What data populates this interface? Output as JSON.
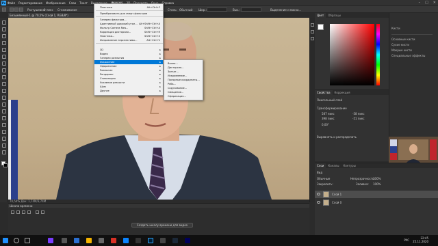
{
  "app": {
    "logo_text": "Ps",
    "menus": [
      "Файл",
      "Редактирование",
      "Изображение",
      "Слои",
      "Текст",
      "Выделение",
      "Фильтр",
      "3D",
      "Просмотр",
      "Окно",
      "Справка"
    ],
    "active_menu_index": 6
  },
  "options": {
    "feather_label": "Растушевка:",
    "feather_value": "0 пикс",
    "anti_alias_label": "Сглаживание",
    "style_label": "Стиль:",
    "style_value": "Обычный",
    "width_label": "Шир.:",
    "height_label": "Выс.:",
    "select_mask_label": "Выделение и маска..."
  },
  "document": {
    "tab_title": "Безымянный-1 @ 70,5% (Слой 1, RGB/8*)",
    "status_text": "70,54%   Док: 1,74M/3,74M"
  },
  "filter_menu": {
    "items": [
      {
        "label": "Пластика",
        "shortcut": "Alt+Ctrl+F"
      },
      {
        "label": "Преобразовать для смарт-фильтров",
        "shortcut": ""
      },
      {
        "label": "Галерея фильтров...",
        "shortcut": ""
      },
      {
        "label": "Адаптивный широкий угол...",
        "shortcut": "Alt+Shift+Ctrl+A"
      },
      {
        "label": "Фильтр Camera Raw...",
        "shortcut": "Shift+Ctrl+A"
      },
      {
        "label": "Коррекция дисторсии...",
        "shortcut": "Shift+Ctrl+R"
      },
      {
        "label": "Пластика...",
        "shortcut": "Shift+Ctrl+X"
      },
      {
        "label": "Исправление перспективы...",
        "shortcut": "Alt+Ctrl+V"
      },
      {
        "label": "3D",
        "shortcut": ""
      },
      {
        "label": "Видео",
        "shortcut": ""
      },
      {
        "label": "Галерея размытия",
        "shortcut": ""
      },
      {
        "label": "Искажение",
        "shortcut": ""
      },
      {
        "label": "Оформление",
        "shortcut": ""
      },
      {
        "label": "Размытие",
        "shortcut": ""
      },
      {
        "label": "Рендеринг",
        "shortcut": ""
      },
      {
        "label": "Стилизация",
        "shortcut": ""
      },
      {
        "label": "Усиление резкости",
        "shortcut": ""
      },
      {
        "label": "Шум",
        "shortcut": ""
      },
      {
        "label": "Другие",
        "shortcut": ""
      }
    ]
  },
  "distort_submenu": {
    "items": [
      "Волна...",
      "Дисторсия...",
      "Зигзаг...",
      "Искривление...",
      "Полярные координаты...",
      "Рябь...",
      "Скручивание...",
      "Смещение...",
      "Сферизация..."
    ]
  },
  "color_panel": {
    "tabs": [
      "Цвет",
      "Образцы"
    ],
    "active_tab": 0,
    "fg_color": "#ffffff"
  },
  "properties_panel": {
    "tabs": [
      "Свойства",
      "Коррекция"
    ],
    "layer_type": "Пиксельный слой",
    "transform_label": "Трансформирование",
    "w_value": "587 пикс",
    "h_value": "398 пикс",
    "x_value": "-58 пикс",
    "y_value": "-51 пикс",
    "angle_value": "0,00°",
    "align_label": "Выровнять и распределить"
  },
  "layers_panel": {
    "tabs": [
      "Слои",
      "Каналы",
      "Контуры"
    ],
    "kind_label": "Вид",
    "blend_mode": "Обычные",
    "opacity_label": "Непрозрачность:",
    "opacity_value": "100%",
    "lock_label": "Закрепить:",
    "fill_label": "Заливка:",
    "fill_value": "100%",
    "layers": [
      {
        "name": "Слой 1",
        "selected": true
      },
      {
        "name": "Слой 0",
        "selected": false
      }
    ]
  },
  "right_column": {
    "title": "Кисти",
    "items": [
      "Основные кисти",
      "Сухие кисти",
      "Мокрые кисти",
      "Специальные эффекты"
    ]
  },
  "timeline": {
    "title": "Шкала времени",
    "create_button": "Создать шкалу времени для видео"
  },
  "taskbar": {
    "lang": "РУС",
    "time": "22:45",
    "date": "25.11.2020"
  }
}
